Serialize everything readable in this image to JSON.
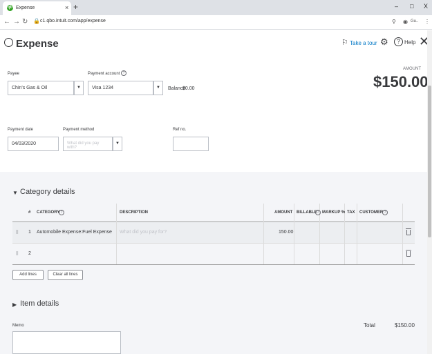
{
  "browser": {
    "tab_title": "Expense",
    "tab_favicon": "qb",
    "new_tab": "+",
    "tab_close": "×",
    "url": "c1.qbo.intuit.com/app/expense",
    "profile": "Gu..",
    "win_min": "–",
    "win_max": "□",
    "win_close": "X"
  },
  "header": {
    "title": "Expense",
    "take_tour": "Take a tour",
    "help": "Help"
  },
  "form": {
    "payee_label": "Payee",
    "payee_value": "Chin's Gas & Oil",
    "payment_account_label": "Payment account",
    "payment_account_value": "Visa 1234",
    "balance_label": "Balance",
    "balance_value": "$0.00",
    "amount_label": "AMOUNT",
    "amount_value": "$150.00",
    "payment_date_label": "Payment date",
    "payment_date_value": "04/03/2020",
    "payment_method_label": "Payment method",
    "payment_method_placeholder": "What did you pay with?",
    "ref_no_label": "Ref no.",
    "ref_no_value": ""
  },
  "category_details": {
    "title": "Category details",
    "columns": [
      "#",
      "CATEGORY",
      "DESCRIPTION",
      "AMOUNT",
      "BILLABLE",
      "MARKUP %",
      "TAX",
      "CUSTOMER"
    ],
    "rows": [
      {
        "num": "1",
        "category": "Automobile Expense:Fuel Expense",
        "description_placeholder": "What did you pay for?",
        "amount": "150.00"
      },
      {
        "num": "2",
        "category": "",
        "description_placeholder": "",
        "amount": ""
      }
    ],
    "add_lines": "Add lines",
    "clear_all_lines": "Clear all lines"
  },
  "item_details": {
    "title": "Item details"
  },
  "footer": {
    "memo_label": "Memo",
    "total_label": "Total",
    "total_value": "$150.00"
  },
  "colors": {
    "brand": "#2ca01c",
    "link": "#0077c5",
    "text": "#393a3d",
    "page_gray": "#f4f5f8"
  }
}
